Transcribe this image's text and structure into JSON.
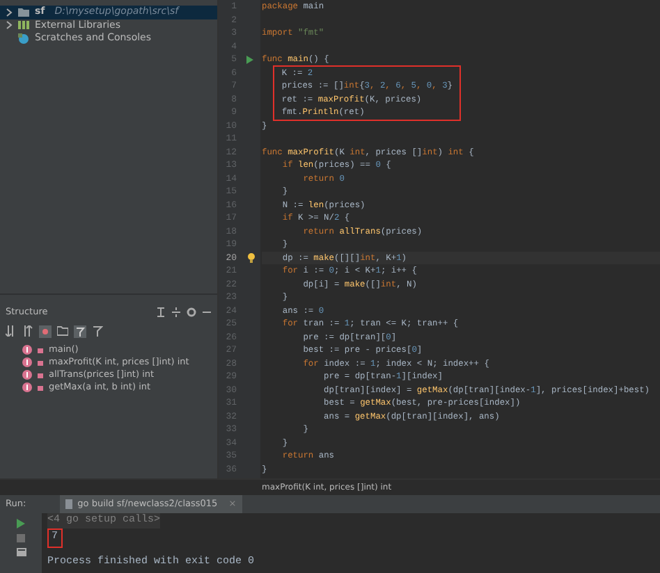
{
  "project_tree": [
    {
      "label": "sf",
      "detail": "D:\\mysetup\\gopath\\src\\sf",
      "kind": "folder",
      "expandable": true,
      "selected": true
    },
    {
      "label": "External Libraries",
      "kind": "library",
      "expandable": true,
      "selected": false
    },
    {
      "label": "Scratches and Consoles",
      "kind": "scratch",
      "expandable": false,
      "selected": false
    }
  ],
  "structure": {
    "title": "Structure",
    "items": [
      {
        "label": "main()"
      },
      {
        "label": "maxProfit(K int, prices []int) int"
      },
      {
        "label": "allTrans(prices []int) int"
      },
      {
        "label": "getMax(a int, b int) int"
      }
    ]
  },
  "editor": {
    "lines": [
      {
        "number": "1",
        "tokens": [
          {
            "text": "package",
            "kind": "kw"
          },
          {
            "text": " main",
            "kind": "id"
          }
        ]
      },
      {
        "number": "2"
      },
      {
        "number": "3",
        "tokens": [
          {
            "text": "import",
            "kind": "kw"
          },
          {
            "text": " \"fmt\"",
            "kind": "str"
          }
        ]
      },
      {
        "number": "4"
      },
      {
        "number": "5",
        "run_marker": true,
        "tokens": [
          {
            "text": "func",
            "kind": "kw"
          },
          {
            "text": " main",
            "kind": "fn"
          },
          {
            "text": "() {",
            "kind": "id"
          }
        ]
      },
      {
        "number": "6",
        "boxed": true,
        "tokens": [
          {
            "text": "    K := ",
            "kind": "id"
          },
          {
            "text": "2",
            "kind": "num"
          }
        ]
      },
      {
        "number": "7",
        "boxed": true,
        "tokens": [
          {
            "text": "    prices := []",
            "kind": "id"
          },
          {
            "text": "int",
            "kind": "kw"
          },
          {
            "text": "{",
            "kind": "id"
          },
          {
            "text": "3",
            "kind": "num"
          },
          {
            "text": ", ",
            "kind": "kw"
          },
          {
            "text": "2",
            "kind": "num"
          },
          {
            "text": ", ",
            "kind": "kw"
          },
          {
            "text": "6",
            "kind": "num"
          },
          {
            "text": ", ",
            "kind": "kw"
          },
          {
            "text": "5",
            "kind": "num"
          },
          {
            "text": ", ",
            "kind": "kw"
          },
          {
            "text": "0",
            "kind": "num"
          },
          {
            "text": ", ",
            "kind": "kw"
          },
          {
            "text": "3",
            "kind": "num"
          },
          {
            "text": "}",
            "kind": "id"
          }
        ]
      },
      {
        "number": "8",
        "boxed": true,
        "tokens": [
          {
            "text": "    ret := ",
            "kind": "id"
          },
          {
            "text": "maxProfit",
            "kind": "fn"
          },
          {
            "text": "(K, prices)",
            "kind": "id"
          }
        ]
      },
      {
        "number": "9",
        "boxed": true,
        "tokens": [
          {
            "text": "    fmt.",
            "kind": "id"
          },
          {
            "text": "Println",
            "kind": "fn"
          },
          {
            "text": "(ret)",
            "kind": "id"
          }
        ]
      },
      {
        "number": "10",
        "tokens": [
          {
            "text": "}",
            "kind": "id"
          }
        ]
      },
      {
        "number": "11"
      },
      {
        "number": "12",
        "tokens": [
          {
            "text": "func",
            "kind": "kw"
          },
          {
            "text": " maxProfit",
            "kind": "fn"
          },
          {
            "text": "(K ",
            "kind": "id"
          },
          {
            "text": "int",
            "kind": "kw"
          },
          {
            "text": ", prices []",
            "kind": "id"
          },
          {
            "text": "int",
            "kind": "kw"
          },
          {
            "text": ") ",
            "kind": "id"
          },
          {
            "text": "int",
            "kind": "kw"
          },
          {
            "text": " {",
            "kind": "id"
          }
        ]
      },
      {
        "number": "13",
        "tokens": [
          {
            "text": "    if",
            "kind": "kw"
          },
          {
            "text": " len",
            "kind": "fn"
          },
          {
            "text": "(prices) == ",
            "kind": "id"
          },
          {
            "text": "0",
            "kind": "num"
          },
          {
            "text": " {",
            "kind": "id"
          }
        ]
      },
      {
        "number": "14",
        "tokens": [
          {
            "text": "        return",
            "kind": "kw"
          },
          {
            "text": " 0",
            "kind": "num"
          }
        ]
      },
      {
        "number": "15",
        "tokens": [
          {
            "text": "    }",
            "kind": "id"
          }
        ]
      },
      {
        "number": "16",
        "tokens": [
          {
            "text": "    N := ",
            "kind": "id"
          },
          {
            "text": "len",
            "kind": "fn"
          },
          {
            "text": "(prices)",
            "kind": "id"
          }
        ]
      },
      {
        "number": "17",
        "tokens": [
          {
            "text": "    if",
            "kind": "kw"
          },
          {
            "text": " K >= N/",
            "kind": "id"
          },
          {
            "text": "2",
            "kind": "num"
          },
          {
            "text": " {",
            "kind": "id"
          }
        ]
      },
      {
        "number": "18",
        "tokens": [
          {
            "text": "        return",
            "kind": "kw"
          },
          {
            "text": " allTrans",
            "kind": "fn"
          },
          {
            "text": "(prices)",
            "kind": "id"
          }
        ]
      },
      {
        "number": "19",
        "tokens": [
          {
            "text": "    }",
            "kind": "id"
          }
        ]
      },
      {
        "number": "20",
        "current": true,
        "hint": true,
        "tokens": [
          {
            "text": "    dp := ",
            "kind": "id"
          },
          {
            "text": "make",
            "kind": "fn"
          },
          {
            "text": "([][]",
            "kind": "id"
          },
          {
            "text": "int",
            "kind": "kw"
          },
          {
            "text": ", K+",
            "kind": "id"
          },
          {
            "text": "1",
            "kind": "num"
          },
          {
            "text": ")",
            "kind": "id"
          }
        ]
      },
      {
        "number": "21",
        "tokens": [
          {
            "text": "    for",
            "kind": "kw"
          },
          {
            "text": " i := ",
            "kind": "id"
          },
          {
            "text": "0",
            "kind": "num"
          },
          {
            "text": "; i < K+",
            "kind": "id"
          },
          {
            "text": "1",
            "kind": "num"
          },
          {
            "text": "; i++ {",
            "kind": "id"
          }
        ]
      },
      {
        "number": "22",
        "tokens": [
          {
            "text": "        dp[i] = ",
            "kind": "id"
          },
          {
            "text": "make",
            "kind": "fn"
          },
          {
            "text": "([]",
            "kind": "id"
          },
          {
            "text": "int",
            "kind": "kw"
          },
          {
            "text": ", N)",
            "kind": "id"
          }
        ]
      },
      {
        "number": "23",
        "tokens": [
          {
            "text": "    }",
            "kind": "id"
          }
        ]
      },
      {
        "number": "24",
        "tokens": [
          {
            "text": "    ans := ",
            "kind": "id"
          },
          {
            "text": "0",
            "kind": "num"
          }
        ]
      },
      {
        "number": "25",
        "tokens": [
          {
            "text": "    for",
            "kind": "kw"
          },
          {
            "text": " tran := ",
            "kind": "id"
          },
          {
            "text": "1",
            "kind": "num"
          },
          {
            "text": "; tran <= K; tran++ {",
            "kind": "id"
          }
        ]
      },
      {
        "number": "26",
        "tokens": [
          {
            "text": "        pre := dp[tran][",
            "kind": "id"
          },
          {
            "text": "0",
            "kind": "num"
          },
          {
            "text": "]",
            "kind": "id"
          }
        ]
      },
      {
        "number": "27",
        "tokens": [
          {
            "text": "        best := pre - prices[",
            "kind": "id"
          },
          {
            "text": "0",
            "kind": "num"
          },
          {
            "text": "]",
            "kind": "id"
          }
        ]
      },
      {
        "number": "28",
        "tokens": [
          {
            "text": "        for",
            "kind": "kw"
          },
          {
            "text": " index := ",
            "kind": "id"
          },
          {
            "text": "1",
            "kind": "num"
          },
          {
            "text": "; index < N; index++ {",
            "kind": "id"
          }
        ]
      },
      {
        "number": "29",
        "tokens": [
          {
            "text": "            pre = dp[tran-",
            "kind": "id"
          },
          {
            "text": "1",
            "kind": "num"
          },
          {
            "text": "][index]",
            "kind": "id"
          }
        ]
      },
      {
        "number": "30",
        "tokens": [
          {
            "text": "            dp[tran][index] = ",
            "kind": "id"
          },
          {
            "text": "getMax",
            "kind": "fn"
          },
          {
            "text": "(dp[tran][index-",
            "kind": "id"
          },
          {
            "text": "1",
            "kind": "num"
          },
          {
            "text": "], prices[index]+best)",
            "kind": "id"
          }
        ]
      },
      {
        "number": "31",
        "tokens": [
          {
            "text": "            best = ",
            "kind": "id"
          },
          {
            "text": "getMax",
            "kind": "fn"
          },
          {
            "text": "(best, pre-prices[index])",
            "kind": "id"
          }
        ]
      },
      {
        "number": "32",
        "tokens": [
          {
            "text": "            ans = ",
            "kind": "id"
          },
          {
            "text": "getMax",
            "kind": "fn"
          },
          {
            "text": "(dp[tran][index], ans)",
            "kind": "id"
          }
        ]
      },
      {
        "number": "33",
        "tokens": [
          {
            "text": "        }",
            "kind": "id"
          }
        ]
      },
      {
        "number": "34",
        "tokens": [
          {
            "text": "    }",
            "kind": "id"
          }
        ]
      },
      {
        "number": "35",
        "tokens": [
          {
            "text": "    return",
            "kind": "kw"
          },
          {
            "text": " ans",
            "kind": "id"
          }
        ]
      },
      {
        "number": "36",
        "tokens": [
          {
            "text": "}",
            "kind": "id"
          }
        ]
      }
    ],
    "breadcrumb": "maxProfit(K int, prices []int) int"
  },
  "run": {
    "label": "Run:",
    "tab": "go build sf/newclass2/class015",
    "close": "×",
    "console": [
      {
        "text": "<4 go setup calls>",
        "kind": "muted"
      },
      {
        "text": "7",
        "kind": "output",
        "boxed": true
      },
      {
        "text": "Process finished with exit code 0",
        "kind": "system"
      }
    ]
  }
}
